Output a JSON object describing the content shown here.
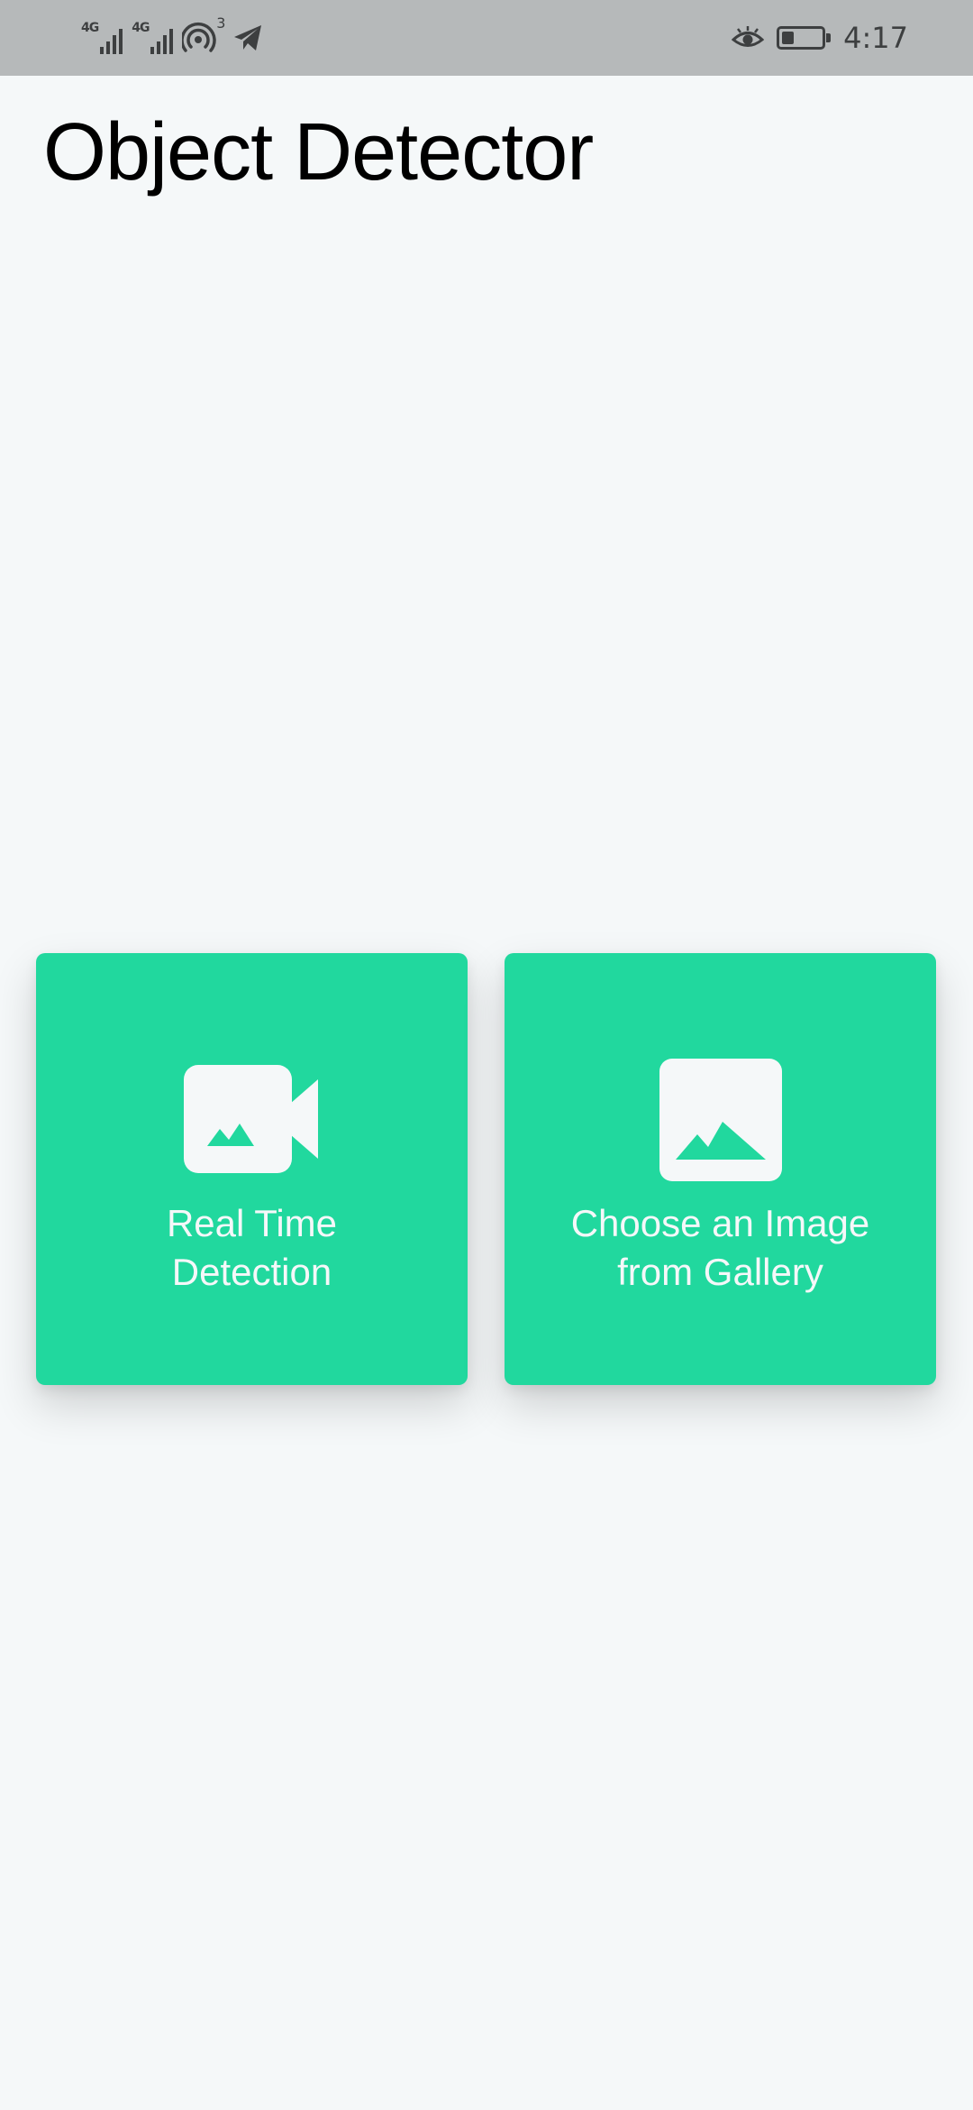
{
  "status_bar": {
    "network_1_label": "4G",
    "network_2_label": "4G",
    "hotspot_count": "3",
    "time": "4:17",
    "battery_level": 0.3,
    "icons": [
      "signal-icon",
      "signal-icon",
      "hotspot-icon",
      "telegram-icon",
      "eye-comfort-icon",
      "battery-icon"
    ]
  },
  "app": {
    "title": "Object Detector"
  },
  "cards": [
    {
      "label_line_1": "Real Time",
      "label_line_2": "Detection",
      "icon": "video-camera-icon"
    },
    {
      "label_line_1": "Choose an Image",
      "label_line_2": "from Gallery",
      "icon": "image-icon"
    }
  ],
  "colors": {
    "accent": "#21d89e",
    "background": "#f5f8f9",
    "status_bar": "#b6b9ba",
    "icon_fill": "#f5f8f9"
  }
}
